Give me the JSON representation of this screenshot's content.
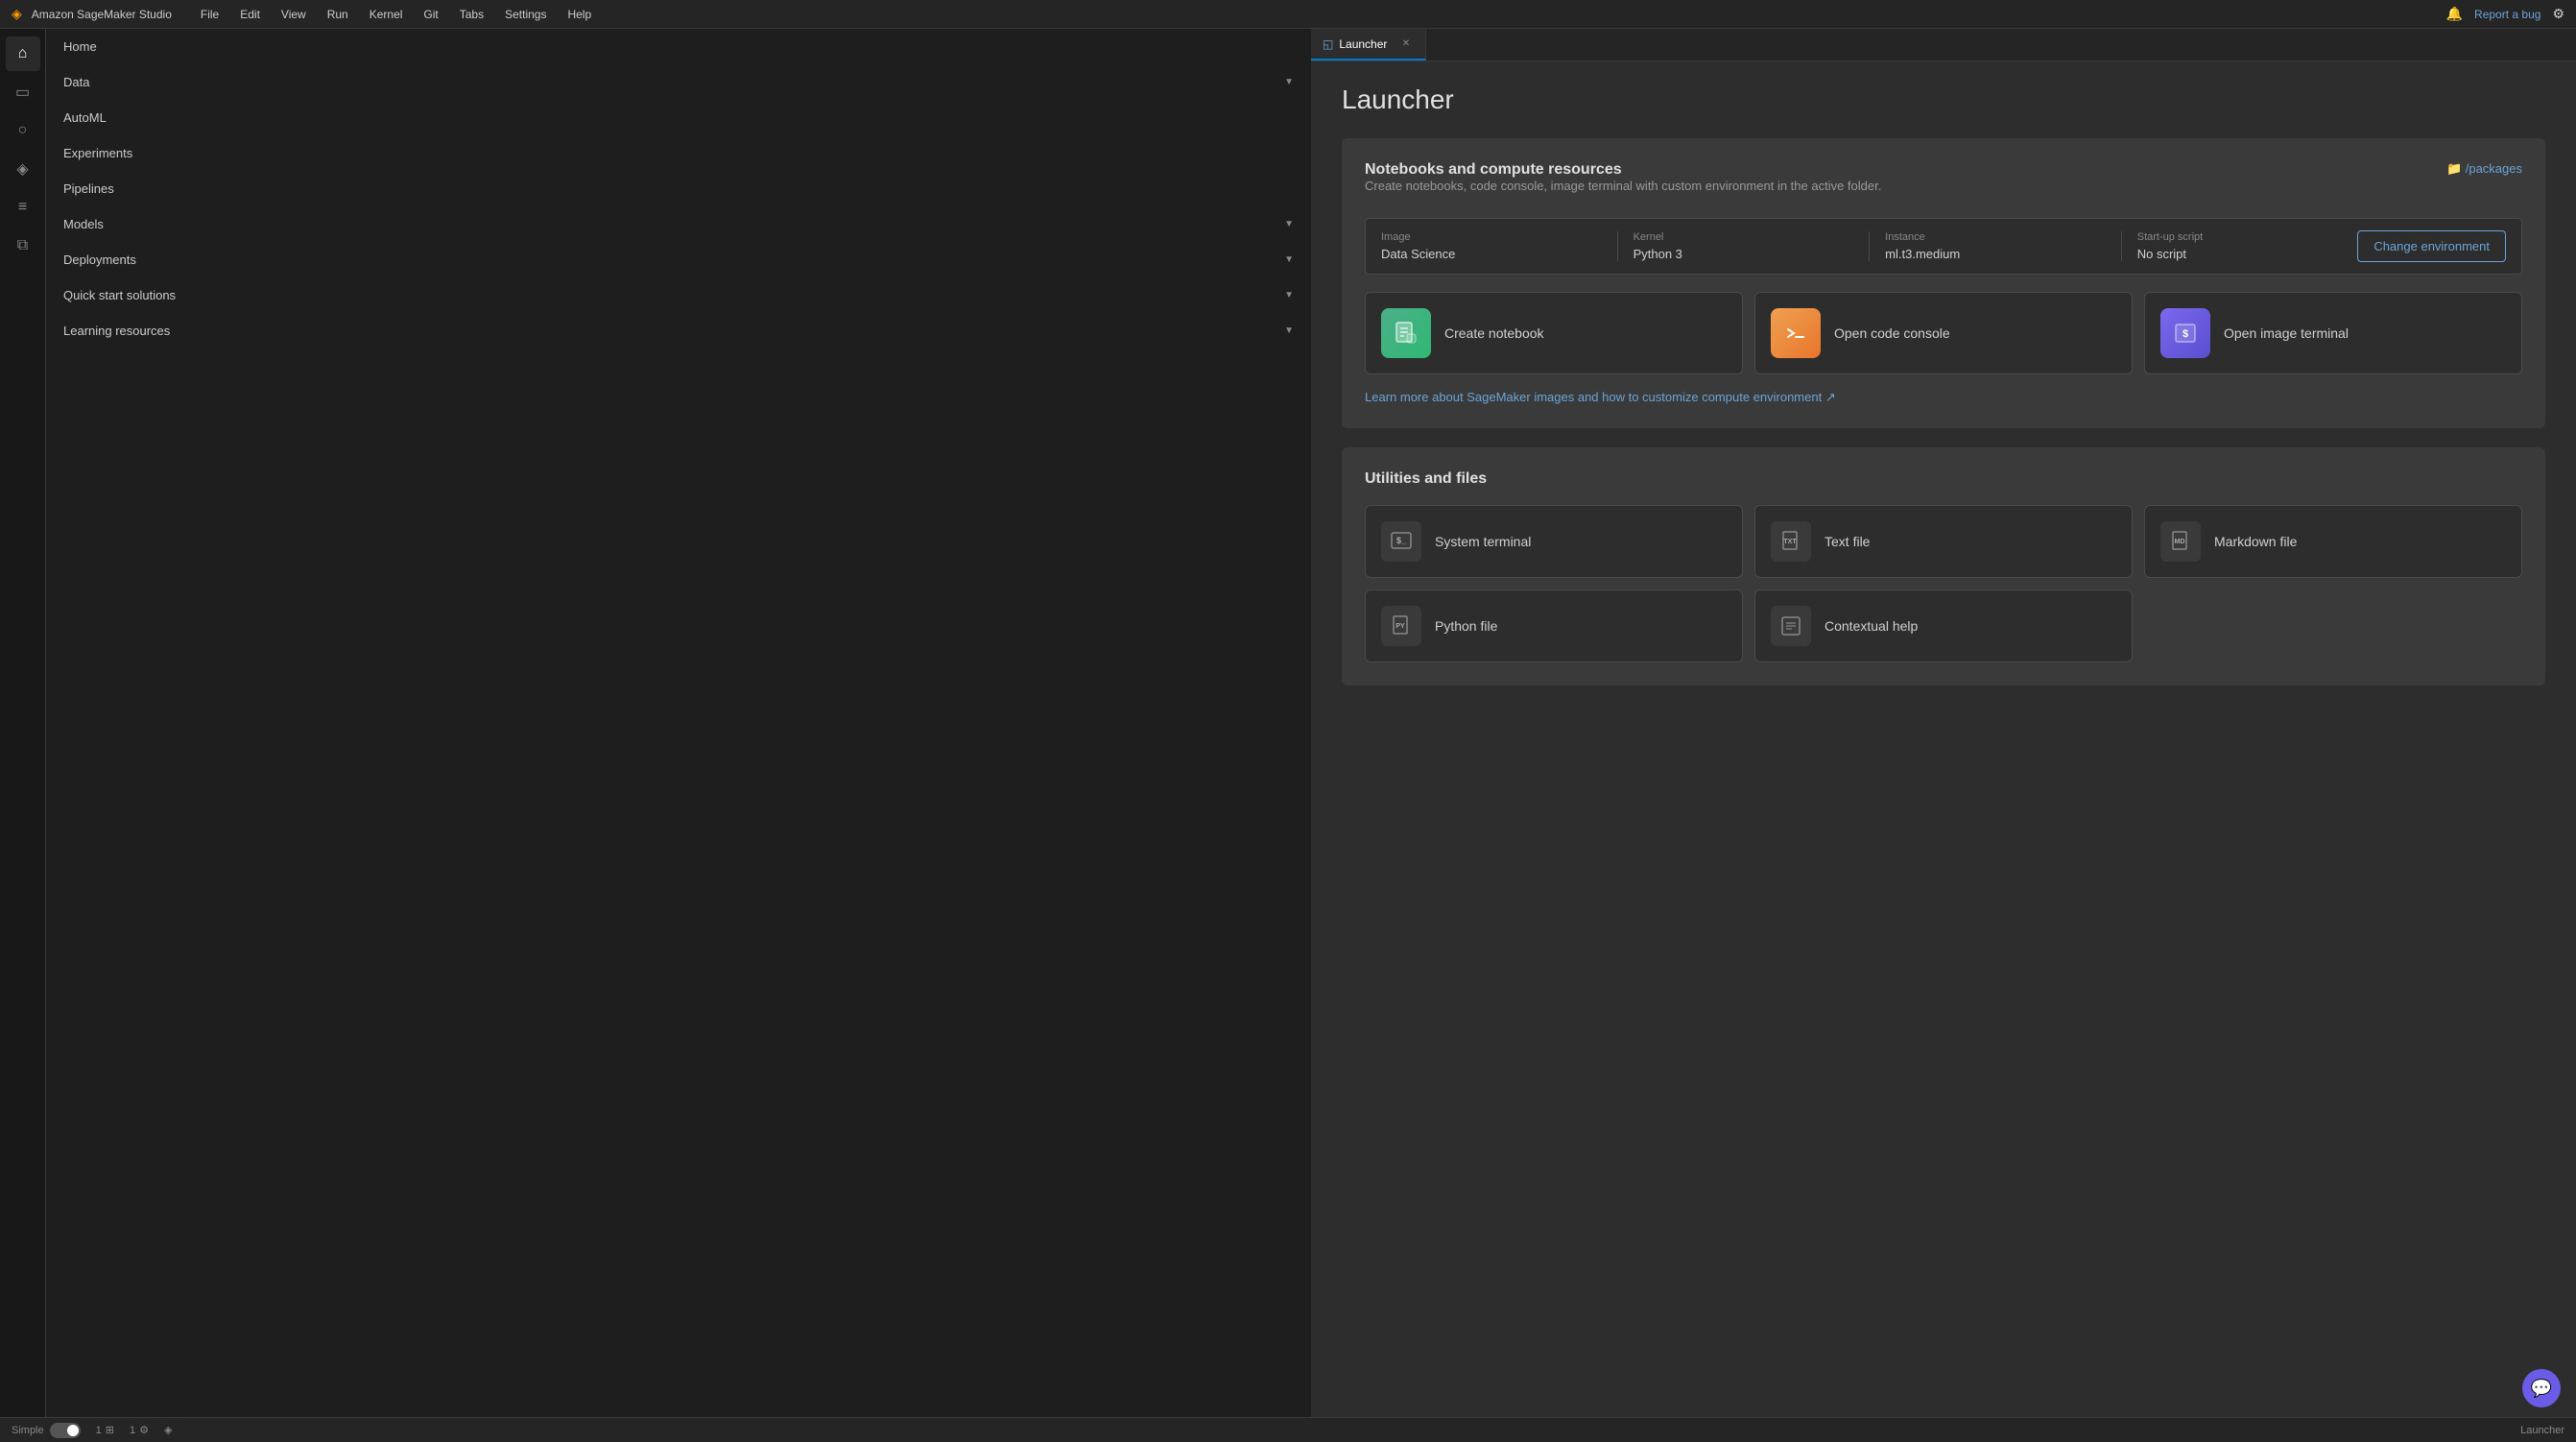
{
  "app": {
    "title": "Amazon SageMaker Studio",
    "logo": "◈"
  },
  "menu": {
    "items": [
      "File",
      "Edit",
      "View",
      "Run",
      "Kernel",
      "Git",
      "Tabs",
      "Settings",
      "Help"
    ]
  },
  "header_actions": {
    "bell_label": "🔔",
    "report_bug": "Report a bug",
    "settings": "⚙"
  },
  "sidebar": {
    "icons": [
      {
        "name": "home-icon",
        "symbol": "⌂",
        "active": true
      },
      {
        "name": "files-icon",
        "symbol": "▭"
      },
      {
        "name": "circle-icon",
        "symbol": "○"
      },
      {
        "name": "git-icon",
        "symbol": "◈"
      },
      {
        "name": "list-icon",
        "symbol": "≡"
      },
      {
        "name": "puzzle-icon",
        "symbol": "⧉"
      }
    ],
    "nav_items": [
      {
        "label": "Home",
        "has_arrow": false,
        "active": false
      },
      {
        "label": "Data",
        "has_arrow": true
      },
      {
        "label": "AutoML",
        "has_arrow": false
      },
      {
        "label": "Experiments",
        "has_arrow": false
      },
      {
        "label": "Pipelines",
        "has_arrow": false
      },
      {
        "label": "Models",
        "has_arrow": true
      },
      {
        "label": "Deployments",
        "has_arrow": true
      },
      {
        "label": "Quick start solutions",
        "has_arrow": true
      },
      {
        "label": "Learning resources",
        "has_arrow": true
      }
    ]
  },
  "tab_bar": {
    "tabs": [
      {
        "label": "Launcher",
        "icon": "◱",
        "active": true,
        "closeable": true
      }
    ]
  },
  "launcher": {
    "title": "Launcher",
    "notebooks_section": {
      "title": "Notebooks and compute resources",
      "subtitle": "Create notebooks, code console, image terminal with custom environment in the active folder.",
      "folder_link": "📁 /packages",
      "env": {
        "image_label": "Image",
        "image_value": "Data Science",
        "kernel_label": "Kernel",
        "kernel_value": "Python 3",
        "instance_label": "Instance",
        "instance_value": "ml.t3.medium",
        "startup_label": "Start-up script",
        "startup_value": "No script"
      },
      "change_env_btn": "Change environment",
      "actions": [
        {
          "label": "Create notebook",
          "icon": "⊞",
          "color": "green"
        },
        {
          "label": "Open code console",
          "icon": "▶",
          "color": "orange"
        },
        {
          "label": "Open image terminal",
          "icon": "$",
          "color": "purple"
        }
      ],
      "learn_link": "Learn more about SageMaker images and how to customize compute environment ↗"
    },
    "utilities_section": {
      "title": "Utilities and files",
      "utilities": [
        {
          "label": "System terminal",
          "icon": "$_",
          "col": 1
        },
        {
          "label": "Text file",
          "icon": "TXT",
          "col": 2
        },
        {
          "label": "Markdown file",
          "icon": "MD",
          "col": 3
        },
        {
          "label": "Python file",
          "icon": "PY",
          "col": 1
        },
        {
          "label": "Contextual help",
          "icon": "⊡",
          "col": 2
        }
      ]
    }
  },
  "status_bar": {
    "mode": "Simple",
    "count1_label": "1",
    "count1_icon": "⊞",
    "count2_label": "1",
    "count2_icon": "⚙",
    "git_icon": "◈",
    "right_label": "Launcher"
  }
}
